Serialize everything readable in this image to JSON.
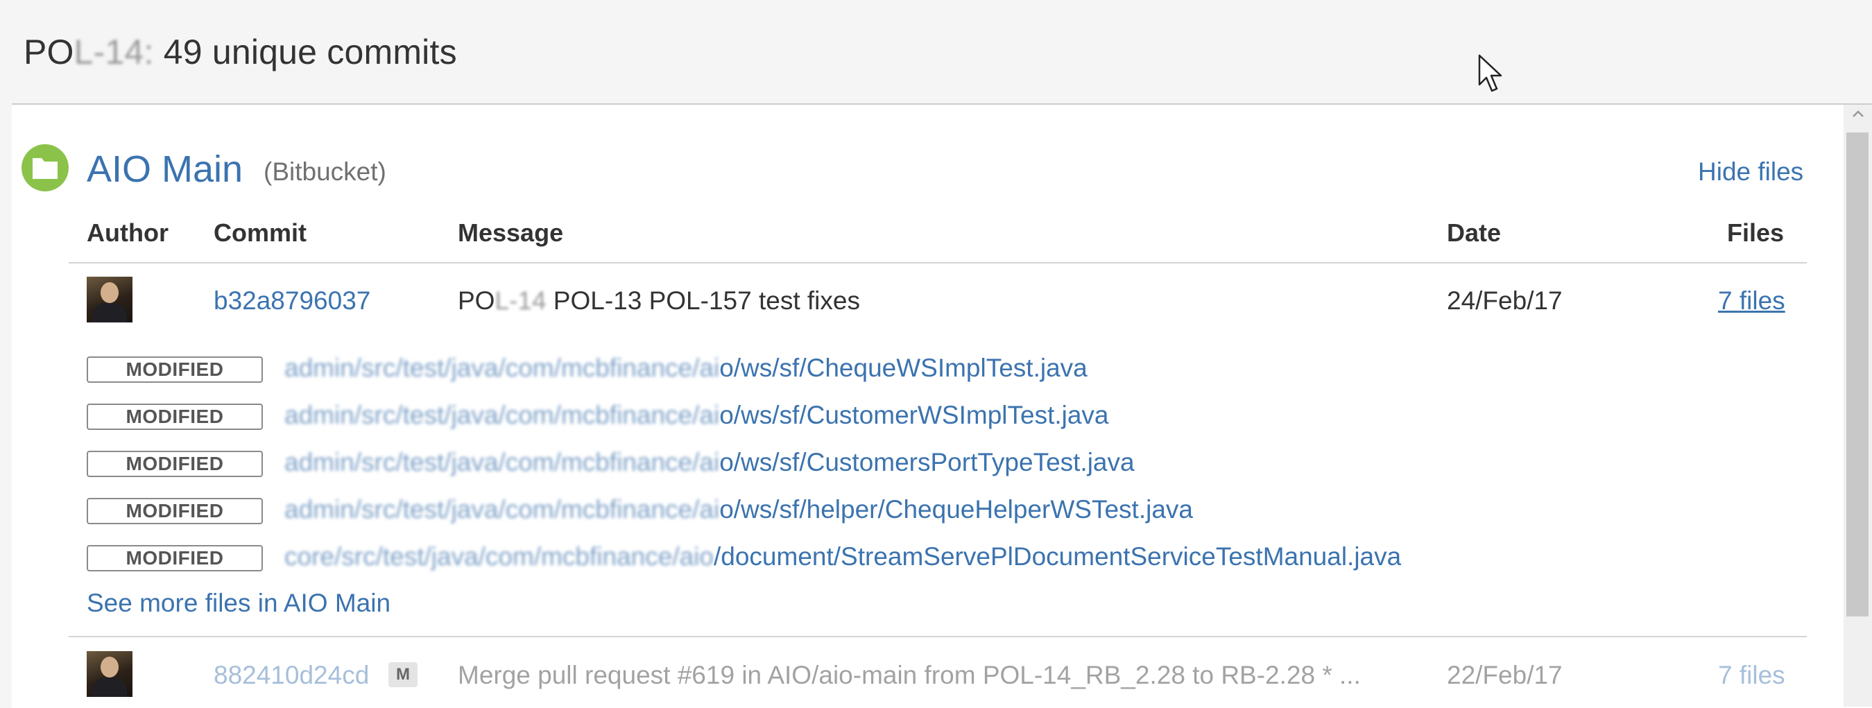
{
  "dialog": {
    "title_key_visible": "PO",
    "title_key_blurred": "L-14:",
    "title_rest": " 49 unique commits"
  },
  "repository": {
    "name": "AIO Main",
    "source": "(Bitbucket)",
    "hide_files_label": "Hide files",
    "icon": "folder-icon",
    "icon_color": "#8bc34a"
  },
  "table": {
    "headers": {
      "author": "Author",
      "commit": "Commit",
      "message": "Message",
      "date": "Date",
      "files": "Files"
    }
  },
  "commits": [
    {
      "hash": "b32a8796037",
      "message_visible_prefix": "PO",
      "message_blurred": "L-14",
      "message_rest": " POL-13 POL-157 test fixes",
      "date": "24/Feb/17",
      "files_label": "7 files"
    },
    {
      "hash": "882410d24cd",
      "merge_badge": "M",
      "message": "Merge pull request #619 in AIO/aio-main from POL-14_RB_2.28 to RB-2.28 * ...",
      "date": "22/Feb/17",
      "files_label": "7 files"
    }
  ],
  "changed_files": [
    {
      "status": "MODIFIED",
      "path_blurred": "admin/src/test/java/com/mcbfinance/ai",
      "path_visible": "o/ws/sf/ChequeWSImplTest.java"
    },
    {
      "status": "MODIFIED",
      "path_blurred": "admin/src/test/java/com/mcbfinance/ai",
      "path_visible": "o/ws/sf/CustomerWSImplTest.java"
    },
    {
      "status": "MODIFIED",
      "path_blurred": "admin/src/test/java/com/mcbfinance/ai",
      "path_visible": "o/ws/sf/CustomersPortTypeTest.java"
    },
    {
      "status": "MODIFIED",
      "path_blurred": "admin/src/test/java/com/mcbfinance/ai",
      "path_visible": "o/ws/sf/helper/ChequeHelperWSTest.java"
    },
    {
      "status": "MODIFIED",
      "path_blurred": "core/src/test/java/com/mcbfinance/aio",
      "path_visible": "/document/StreamServePlDocumentServiceTestManual.java"
    }
  ],
  "see_more_label": "See more files in AIO Main"
}
